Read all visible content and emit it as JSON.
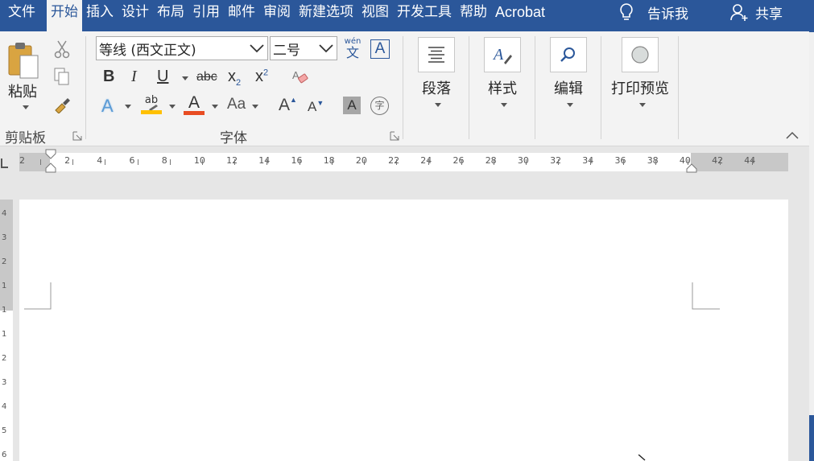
{
  "tabs": [
    {
      "label": "文件",
      "active": false
    },
    {
      "label": "开始",
      "active": true
    },
    {
      "label": "插入",
      "active": false
    },
    {
      "label": "设计",
      "active": false
    },
    {
      "label": "布局",
      "active": false
    },
    {
      "label": "引用",
      "active": false
    },
    {
      "label": "邮件",
      "active": false
    },
    {
      "label": "审阅",
      "active": false
    },
    {
      "label": "新建选项",
      "active": false
    },
    {
      "label": "视图",
      "active": false
    },
    {
      "label": "开发工具",
      "active": false
    },
    {
      "label": "帮助",
      "active": false
    },
    {
      "label": "Acrobat",
      "active": false
    }
  ],
  "tell_me": {
    "label": "告诉我",
    "icon": "lightbulb-icon"
  },
  "share": {
    "label": "共享",
    "icon": "person-add-icon"
  },
  "clipboard": {
    "paste_label": "粘贴",
    "group_label": "剪贴板"
  },
  "font": {
    "font_name": "等线 (西文正文)",
    "font_size": "二号",
    "phonetic_top": "wén",
    "phonetic_bottom": "文",
    "border_char": "A",
    "bold": "B",
    "italic": "I",
    "underline": "U",
    "strike": "abc",
    "sub": "x",
    "sub_mark": "2",
    "sup": "x",
    "sup_mark": "2",
    "effects": "A",
    "highlight": "ab",
    "font_color": "A",
    "change_case": "Aa",
    "grow": "A",
    "shrink": "A",
    "shading": "A",
    "enclose": "字",
    "group_label": "字体"
  },
  "paragraph": {
    "label": "段落"
  },
  "styles": {
    "label": "样式"
  },
  "editing": {
    "label": "编辑"
  },
  "print_preview": {
    "label": "打印预览"
  },
  "ruler_numbers": [
    "2",
    "2",
    "4",
    "6",
    "8",
    "10",
    "12",
    "14",
    "16",
    "18",
    "20",
    "22",
    "24",
    "26",
    "28",
    "30",
    "32",
    "34",
    "36",
    "38",
    "40",
    "42",
    "44"
  ],
  "vruler_numbers": [
    "4",
    "3",
    "2",
    "1",
    "1",
    "1",
    "2",
    "3",
    "4",
    "5",
    "6"
  ],
  "colors": {
    "accent": "#2b579a",
    "highlight_bar": "#ffc000",
    "font_color_bar": "#e84c22",
    "ribbon_bg": "#f3f3f3"
  }
}
